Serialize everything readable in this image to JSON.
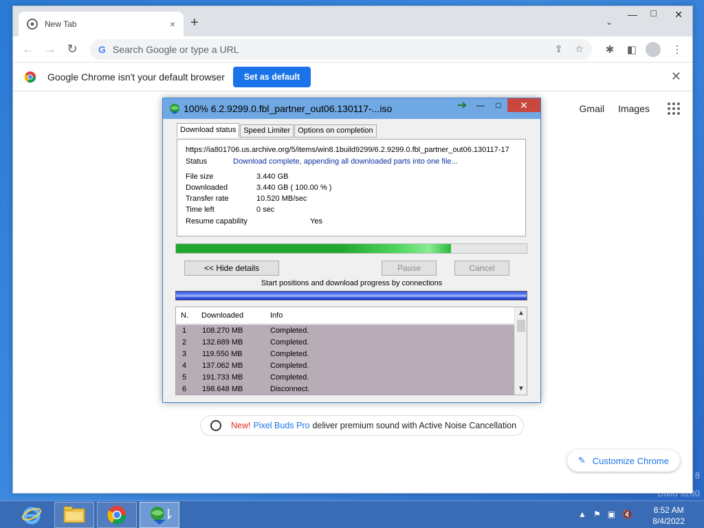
{
  "desktop": {
    "watermark_line1": "8",
    "watermark_line2": "Build 9200"
  },
  "chrome": {
    "tab_title": "New Tab",
    "tab_close": "×",
    "new_tab": "+",
    "tab_search": "⌄",
    "minimize": "—",
    "maximize": "□",
    "close": "✕",
    "back": "←",
    "forward": "→",
    "reload": "↻",
    "omnibox_g": "G",
    "omnibox_placeholder": "Search Google or type a URL",
    "share_icon": "⇪",
    "star_icon": "☆",
    "extensions_icon": "✱",
    "sidepanel_icon": "◧",
    "menu_icon": "⋮",
    "infobar_message": "Google Chrome isn't your default browser",
    "infobar_button": "Set as default",
    "infobar_close": "✕",
    "gmail": "Gmail",
    "images": "Images",
    "promo_new": "New!",
    "promo_product": "Pixel Buds Pro",
    "promo_text": "deliver premium sound with Active Noise Cancellation",
    "customize": "Customize Chrome",
    "customize_icon": "✎"
  },
  "idm": {
    "title": "100% 6.2.9299.0.fbl_partner_out06.130117-...iso",
    "tabs": [
      "Download status",
      "Speed Limiter",
      "Options on completion"
    ],
    "url": "https://ia801706.us.archive.org/5/items/win8.1build9299/6.2.9299.0.fbl_partner_out06.130117-17",
    "status_label": "Status",
    "status_value": "Download complete, appending all downloaded parts into one file...",
    "file_size_label": "File size",
    "file_size_value": "3.440  GB",
    "downloaded_label": "Downloaded",
    "downloaded_value": "3.440  GB  ( 100.00 % )",
    "transfer_rate_label": "Transfer rate",
    "transfer_rate_value": "10.520  MB/sec",
    "time_left_label": "Time left",
    "time_left_value": "0 sec",
    "resume_label": "Resume capability",
    "resume_value": "Yes",
    "progress_fraction": 0.785,
    "hide_details": "<< Hide details",
    "pause": "Pause",
    "cancel": "Cancel",
    "connections_caption": "Start positions and download progress by connections",
    "columns": [
      "N.",
      "Downloaded",
      "Info"
    ],
    "connections": [
      {
        "n": "1",
        "downloaded": "108.270  MB",
        "info": "Completed."
      },
      {
        "n": "2",
        "downloaded": "132.689  MB",
        "info": "Completed."
      },
      {
        "n": "3",
        "downloaded": "119.550  MB",
        "info": "Completed."
      },
      {
        "n": "4",
        "downloaded": "137.062  MB",
        "info": "Completed."
      },
      {
        "n": "5",
        "downloaded": "191.733  MB",
        "info": "Completed."
      },
      {
        "n": "6",
        "downloaded": "198.648  MB",
        "info": "Disconnect."
      }
    ]
  },
  "taskbar": {
    "time": "8:52 AM",
    "date": "8/4/2022"
  }
}
